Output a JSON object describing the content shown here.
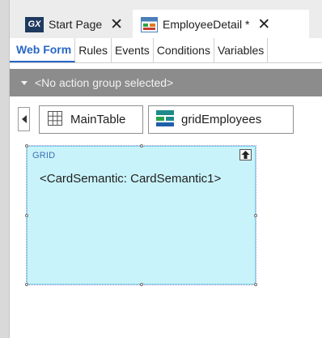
{
  "tabs": [
    {
      "label": "Start Page",
      "icon": "gx-logo-icon",
      "close": "✕"
    },
    {
      "label": "EmployeeDetail *",
      "icon": "employee-detail-icon",
      "close": "✕"
    }
  ],
  "subtabs": [
    "Web Form",
    "Rules",
    "Events",
    "Conditions",
    "Variables"
  ],
  "action_group": {
    "text": "<No action group selected>"
  },
  "breadcrumbs": [
    {
      "label": "MainTable",
      "icon": "table-icon"
    },
    {
      "label": "gridEmployees",
      "icon": "grid-icon"
    }
  ],
  "grid": {
    "label": "GRID",
    "content": "<CardSemantic: CardSemantic1>"
  },
  "colors": {
    "accent": "#2867c5",
    "grid_bg": "#c9f3fa",
    "action_bar": "#8c8c8c"
  }
}
